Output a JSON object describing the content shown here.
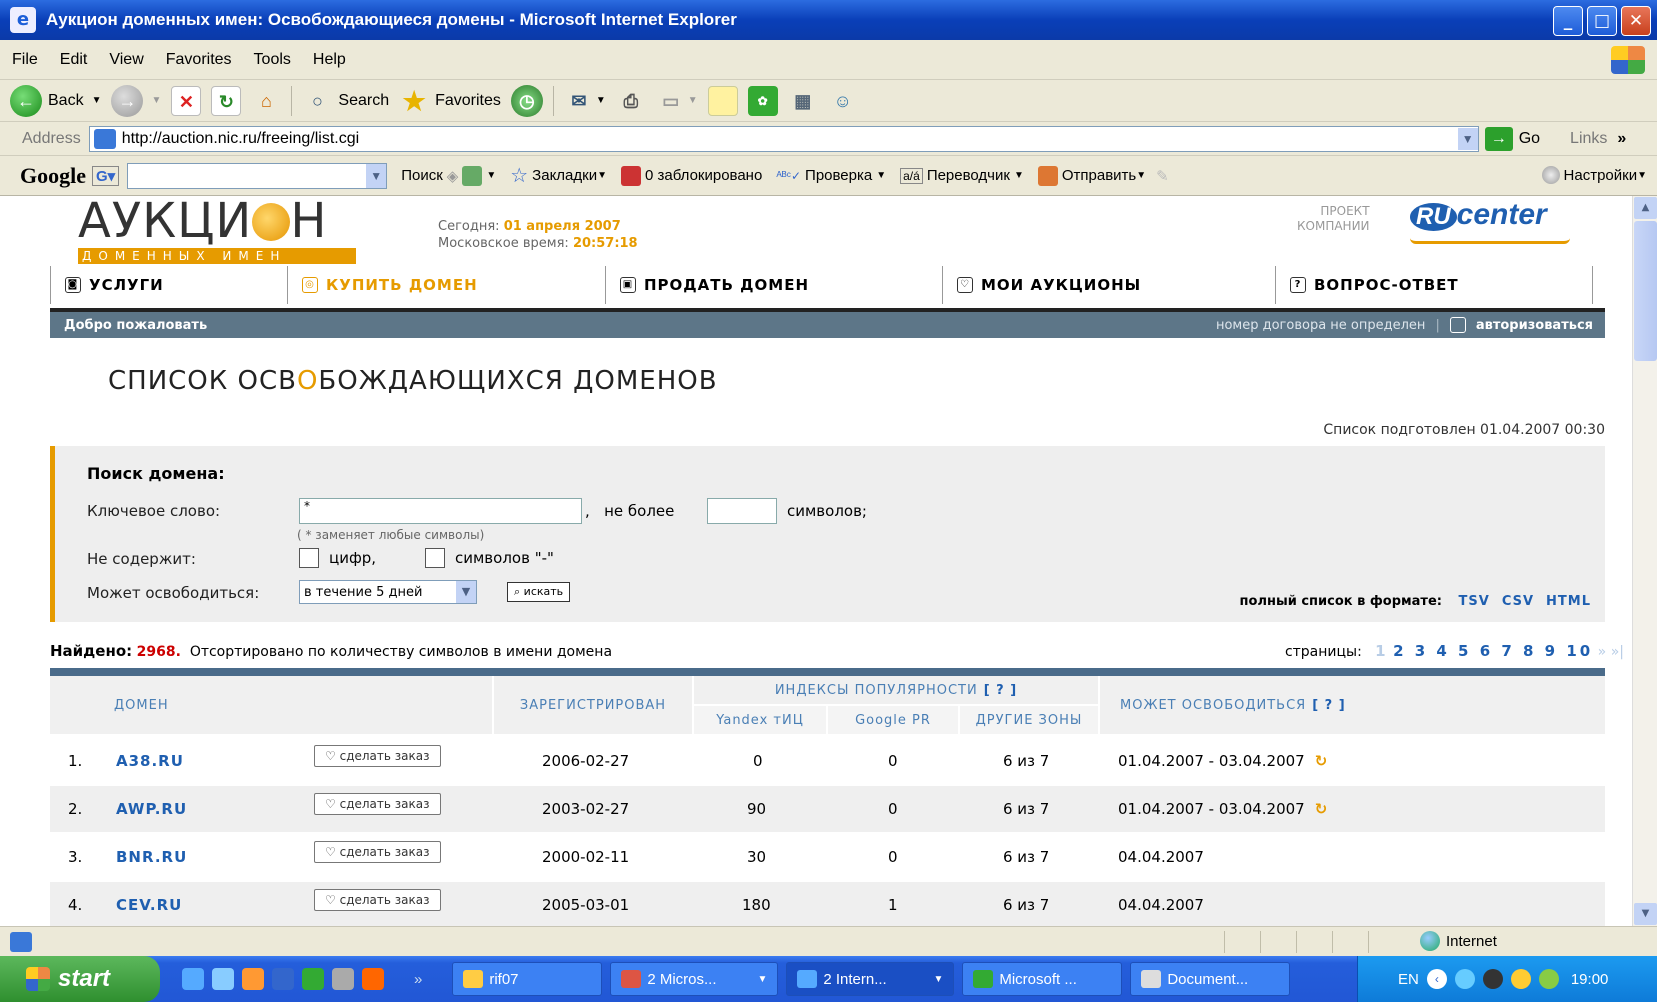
{
  "window": {
    "title": "Аукцион доменных имен: Освобождающиеся домены - Microsoft Internet Explorer",
    "min": "_",
    "max": "□",
    "close": "✕"
  },
  "menu": [
    "File",
    "Edit",
    "View",
    "Favorites",
    "Tools",
    "Help"
  ],
  "toolbar": {
    "back": "Back",
    "search": "Search",
    "favorites": "Favorites"
  },
  "address": {
    "label": "Address",
    "url": "http://auction.nic.ru/freeing/list.cgi",
    "go": "Go",
    "links": "Links"
  },
  "google_bar": {
    "logo": "Google",
    "search": "Поиск",
    "bookmarks": "Закладки",
    "blocked": "0 заблокировано",
    "spell": "Проверка",
    "translate": "Переводчик",
    "send": "Отправить",
    "settings": "Настройки"
  },
  "site": {
    "logo_main_1": "АУКЦИ",
    "logo_main_2": "Н",
    "logo_sub": "ДОМЕННЫХ ИМЕН",
    "today_label": "Сегодня:",
    "today_date": "01 апреля 2007",
    "time_label": "Московское время:",
    "time_value": "20:57:18",
    "project_line1": "ПРОЕКТ",
    "project_line2": "КОМПАНИИ",
    "rucenter_ru": "RU",
    "rucenter_rest": "center"
  },
  "nav": [
    {
      "label": "УСЛУГИ"
    },
    {
      "label": "КУПИТЬ ДОМЕН"
    },
    {
      "label": "ПРОДАТЬ ДОМЕН"
    },
    {
      "label": "МОИ АУКЦИОНЫ"
    },
    {
      "label": "ВОПРОС-ОТВЕТ"
    }
  ],
  "welcome": {
    "left": "Добро пожаловать",
    "contract": "номер договора не определен",
    "login": "авторизоваться"
  },
  "page": {
    "title_1": "СПИСОК ОСВ",
    "title_o": "О",
    "title_2": "БОЖДАЮЩИХСЯ ДОМЕНОВ",
    "prepared": "Список подготовлен 01.04.2007 00:30"
  },
  "search": {
    "title": "Поиск домена:",
    "keyword_label": "Ключевое слово:",
    "keyword_value": "*",
    "hint": "( * заменяет любые символы)",
    "not_more_1": ",",
    "not_more_2": "не более",
    "symbols": "символов;",
    "not_contains_label": "Не содержит:",
    "no_digits": "цифр,",
    "no_dash": "символов \"-\"",
    "may_free_label": "Может освободиться:",
    "period_value": "в течение 5 дней",
    "search_button": "искать",
    "format_label": "полный список в формате:",
    "formats": [
      "TSV",
      "CSV",
      "HTML"
    ]
  },
  "results": {
    "found_label": "Найдено:",
    "found_count": "2968.",
    "sort_text": "Отсортировано по количеству символов в имени домена",
    "pages_label": "страницы:",
    "pages": "1 2 3 4 5 6 7 8 9 10",
    "page_current": "1",
    "page_others": "2 3 4 5 6 7 8 9 10",
    "next": "»",
    "last": "»|"
  },
  "table": {
    "headers": {
      "domain": "ДОМЕН",
      "registered": "ЗАРЕГИСТРИРОВАН",
      "popularity": "ИНДЕКСЫ ПОПУЛЯРНОСТИ",
      "qm": "[ ? ]",
      "yandex": "Yandex тИЦ",
      "google": "Google PR",
      "zones": "ДРУГИЕ ЗОНЫ",
      "may_free": "МОЖЕТ ОСВОБОДИТЬСЯ",
      "qm2": "[ ? ]"
    },
    "order_button": "сделать заказ",
    "rows": [
      {
        "n": "1.",
        "domain": "A38.RU",
        "registered": "2006-02-27",
        "yandex": "0",
        "google": "0",
        "zones": "6 из 7",
        "free": "01.04.2007 - 03.04.2007",
        "refresh": "↻"
      },
      {
        "n": "2.",
        "domain": "AWP.RU",
        "registered": "2003-02-27",
        "yandex": "90",
        "google": "0",
        "zones": "6 из 7",
        "free": "01.04.2007 - 03.04.2007",
        "refresh": "↻"
      },
      {
        "n": "3.",
        "domain": "BNR.RU",
        "registered": "2000-02-11",
        "yandex": "30",
        "google": "0",
        "zones": "6 из 7",
        "free": "04.04.2007",
        "refresh": ""
      },
      {
        "n": "4.",
        "domain": "CEV.RU",
        "registered": "2005-03-01",
        "yandex": "180",
        "google": "1",
        "zones": "6 из 7",
        "free": "04.04.2007",
        "refresh": ""
      }
    ]
  },
  "status": {
    "zone": "Internet"
  },
  "taskbar": {
    "start": "start",
    "tasks": [
      "rif07",
      "2 Micros...",
      "2 Intern...",
      "Microsoft ...",
      "Document..."
    ],
    "lang": "EN",
    "clock": "19:00"
  },
  "colors": {
    "accent": "#e69b00",
    "link": "#1f5fb0",
    "welcome_bar": "#5d7688",
    "red_count": "#cc0000"
  }
}
